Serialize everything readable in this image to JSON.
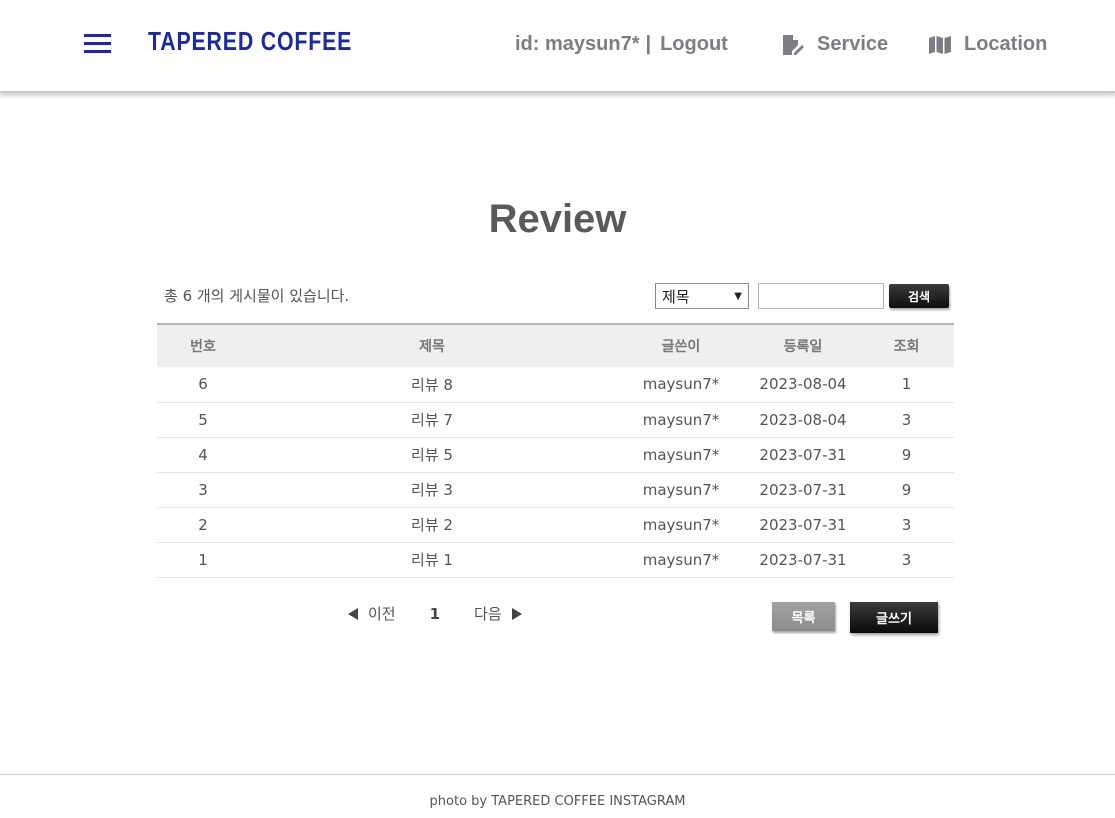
{
  "header": {
    "logo": "TAPERED COFFEE",
    "user_id": "id: maysun7*",
    "separator": "|",
    "logout_label": "Logout",
    "nav": {
      "service_label": "Service",
      "location_label": "Location"
    }
  },
  "main": {
    "title": "Review",
    "count_text": "총 6 개의 게시물이 있습니다.",
    "search": {
      "field_selected": "제목",
      "input_value": "",
      "button_label": "검색"
    },
    "table": {
      "headers": [
        "번호",
        "제목",
        "글쓴이",
        "등록일",
        "조회"
      ],
      "rows": [
        {
          "no": "6",
          "title": "리뷰 8",
          "writer": "maysun7*",
          "date": "2023-08-04",
          "views": "1"
        },
        {
          "no": "5",
          "title": "리뷰 7",
          "writer": "maysun7*",
          "date": "2023-08-04",
          "views": "3"
        },
        {
          "no": "4",
          "title": "리뷰 5",
          "writer": "maysun7*",
          "date": "2023-07-31",
          "views": "9"
        },
        {
          "no": "3",
          "title": "리뷰 3",
          "writer": "maysun7*",
          "date": "2023-07-31",
          "views": "9"
        },
        {
          "no": "2",
          "title": "리뷰 2",
          "writer": "maysun7*",
          "date": "2023-07-31",
          "views": "3"
        },
        {
          "no": "1",
          "title": "리뷰 1",
          "writer": "maysun7*",
          "date": "2023-07-31",
          "views": "3"
        }
      ]
    },
    "pager": {
      "prev_label": "이전",
      "current_page": "1",
      "next_label": "다음"
    },
    "list_button": "목록",
    "write_button": "글쓰기"
  },
  "footer": {
    "text": "photo by TAPERED COFFEE INSTAGRAM"
  },
  "colors": {
    "brand": "#1a2aa6",
    "nav_text": "#7d7d85"
  }
}
